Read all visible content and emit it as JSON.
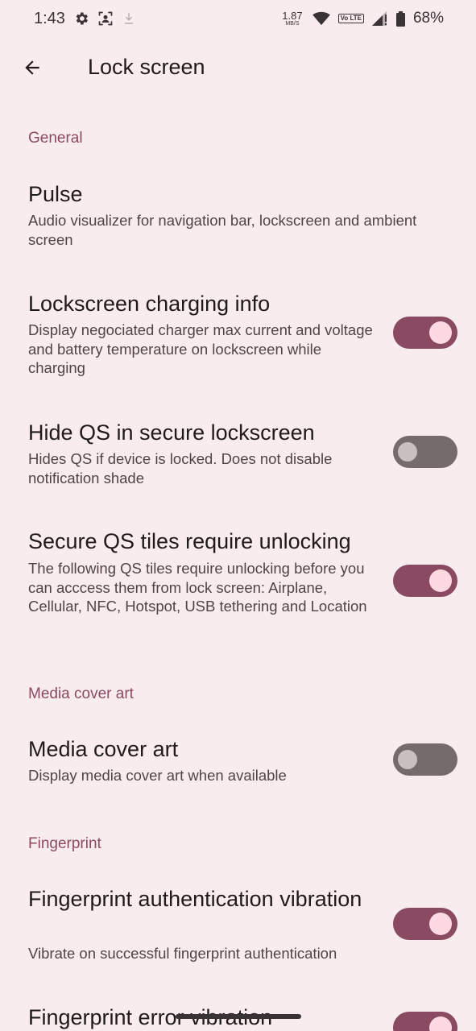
{
  "status_bar": {
    "time": "1:43",
    "net_speed_value": "1.87",
    "net_speed_unit": "MB/S",
    "volte_label": "Vo LTE",
    "battery": "68%"
  },
  "header": {
    "title": "Lock screen"
  },
  "sections": {
    "general": "General",
    "media": "Media cover art",
    "fingerprint": "Fingerprint"
  },
  "prefs": {
    "pulse": {
      "title": "Pulse",
      "summary": "Audio visualizer for navigation bar, lockscreen and ambient screen"
    },
    "charging_info": {
      "title": "Lockscreen charging info",
      "summary": "Display negociated charger max current and voltage and battery temperature on lockscreen while charging",
      "enabled": true
    },
    "hide_qs": {
      "title": "Hide QS in secure lockscreen",
      "summary": "Hides QS if device is locked. Does not disable notification shade",
      "enabled": false
    },
    "secure_qs": {
      "title": "Secure QS tiles require unlocking",
      "summary": "The following QS tiles require unlocking before you can acccess them from lock screen: Airplane, Cellular, NFC, Hotspot, USB tethering and Location",
      "enabled": true
    },
    "media_art": {
      "title": "Media cover art",
      "summary": "Display media cover art when available",
      "enabled": false
    },
    "fp_auth_vibration": {
      "title": "Fingerprint authentication vibration",
      "summary": "Vibrate on successful fingerprint authentication",
      "enabled": true
    },
    "fp_error_vibration": {
      "title": "Fingerprint error vibration",
      "enabled": true
    }
  },
  "colors": {
    "background": "#f9ecee",
    "accent": "#8c4a60",
    "switch_on": "#8a4a62",
    "switch_off": "#756b6d"
  }
}
